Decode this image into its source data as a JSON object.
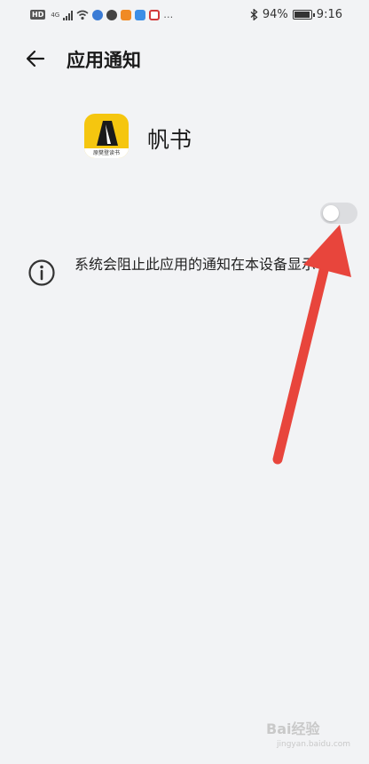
{
  "status_bar": {
    "network": "4G",
    "hd": "HD",
    "battery_percent": "94%",
    "battery_level": 0.94,
    "time": "9:16",
    "more_icon": "…",
    "notification_icons": [
      "paw-icon",
      "chat-icon",
      "play-icon",
      "music-icon",
      "app-icon"
    ]
  },
  "header": {
    "title": "应用通知",
    "back_icon": "arrow-left-icon"
  },
  "app": {
    "name": "帆书",
    "icon_caption": "原樊登读书",
    "icon_color": "#f5c60f"
  },
  "notification_toggle": {
    "state": "off"
  },
  "info": {
    "icon": "info-circle-icon",
    "text": "系统会阻止此应用的通知在本设备显示"
  },
  "watermark": {
    "text": "Bai经验",
    "sub": "jingyan.baidu.com"
  },
  "colors": {
    "background": "#f2f3f5",
    "toggle_off": "#dcdde0",
    "annotation_arrow": "#e8453c"
  }
}
